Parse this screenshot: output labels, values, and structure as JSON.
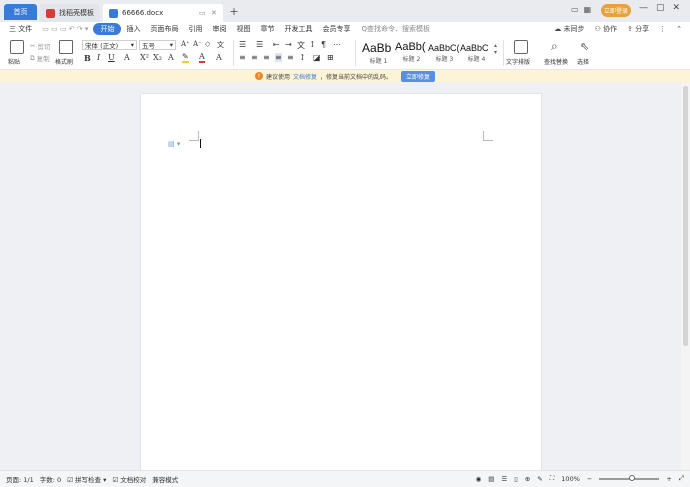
{
  "titlebar": {
    "home_tab": "首页",
    "tabs": [
      {
        "label": "找稻壳模板"
      },
      {
        "label": "66666.docx"
      }
    ],
    "login_label": "立即登录"
  },
  "menubar": {
    "file_label": "三 文件",
    "items": [
      "开始",
      "插入",
      "页面布局",
      "引用",
      "审阅",
      "视图",
      "章节",
      "开发工具",
      "会员专享"
    ],
    "active_item": "开始",
    "search_label": "Q查找命令、搜索模板",
    "sync_label": "未同步",
    "collab_label": "协作",
    "share_label": "分享"
  },
  "ribbon": {
    "paste_label": "粘贴",
    "cut_label": "剪切",
    "copy_label": "复制",
    "format_painter_label": "格式刷",
    "font_name": "宋体 (正文)",
    "font_size": "五号",
    "styles": [
      {
        "sample": "AaBb",
        "name": "标题 1"
      },
      {
        "sample": "AaBb(",
        "name": "标题 2"
      },
      {
        "sample": "AaBbC(",
        "name": "标题 3"
      },
      {
        "sample": "AaBbC",
        "name": "标题 4"
      }
    ],
    "text_layout_label": "文字排版",
    "find_replace_label": "查找替换",
    "select_label": "选择"
  },
  "notice": {
    "prefix": "建议使用",
    "link": "文档修复",
    "suffix": "，修复当前文档中的乱码。",
    "button": "立即修复"
  },
  "statusbar": {
    "page": "页面: 1/1",
    "word_count": "字数: 0",
    "spell_check": "拼写检查",
    "proofread": "文档校对",
    "compat_mode": "兼容模式",
    "zoom": "100%",
    "zoom_level": 0.55
  },
  "colors": {
    "accent": "#3b7bd8",
    "notice_bg": "#fdf3d6",
    "login": "#e9a23b"
  }
}
